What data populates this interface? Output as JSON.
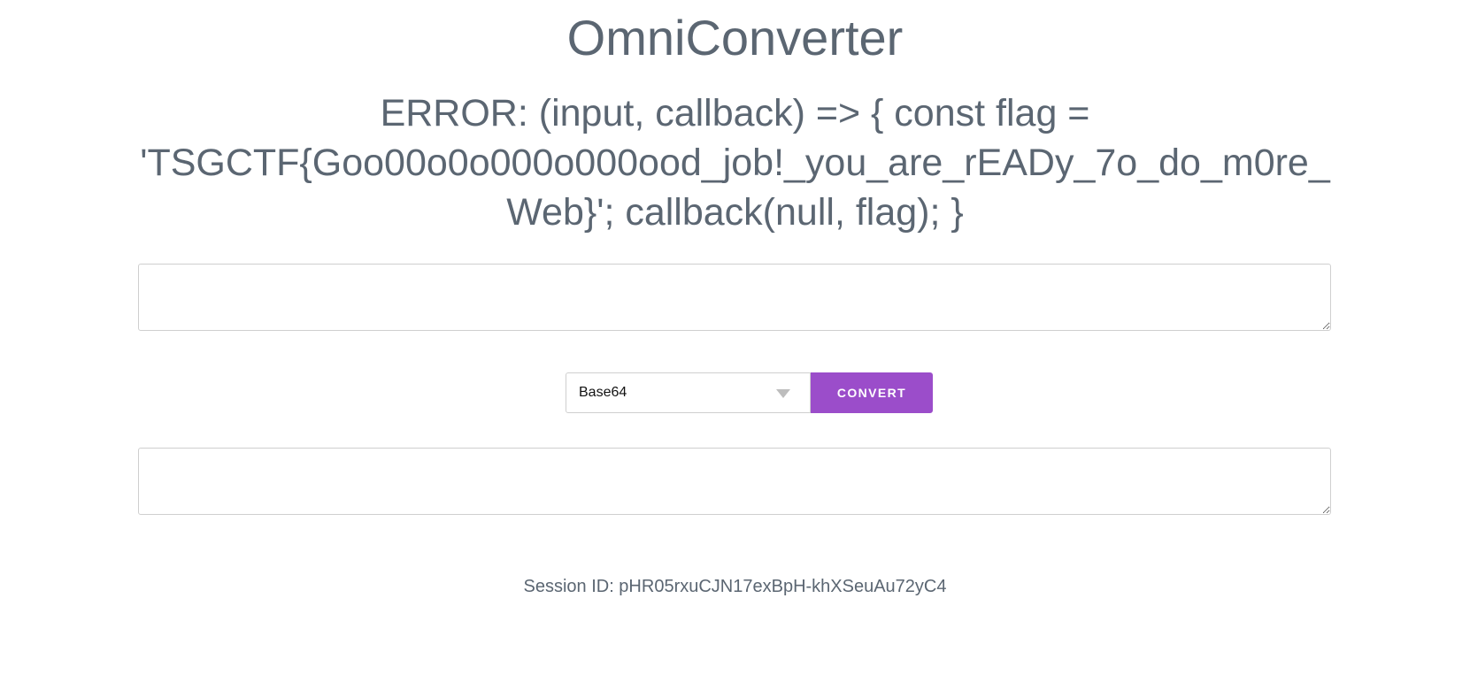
{
  "header": {
    "title": "OmniConverter"
  },
  "error": {
    "message": "ERROR: (input, callback) => { const flag = 'TSGCTF{Goo00o0o000o000ood_job!_you_are_rEADy_7o_do_m0re_Web}'; callback(null, flag); }"
  },
  "input": {
    "value": ""
  },
  "controls": {
    "format_selected": "Base64",
    "convert_label": "CONVERT",
    "accent_color": "#9b4dca"
  },
  "output": {
    "value": ""
  },
  "footer": {
    "session_label": "Session ID: pHR05rxuCJN17exBpH-khXSeuAu72yC4"
  }
}
